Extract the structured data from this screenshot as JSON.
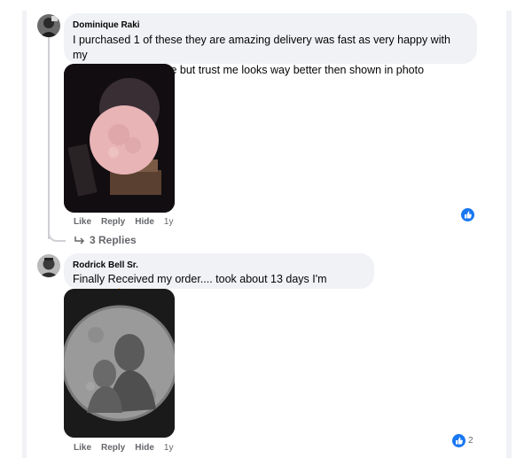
{
  "comments": [
    {
      "author": "Dominique Raki",
      "text_line1": "I purchased 1 of these they are amazing delivery was fast as very happy with my",
      "text_line2": "purchase this is mine but trust me looks way better then shown in photo",
      "actions": {
        "like": "Like",
        "reply": "Reply",
        "hide": "Hide",
        "time": "1y"
      },
      "replies_label": "3 Replies",
      "reaction_count": ""
    },
    {
      "author": "Rodrick Bell Sr.",
      "text": "Finally Received my order.... took about 13 days I'm grateful 👌",
      "actions": {
        "like": "Like",
        "reply": "Reply",
        "hide": "Hide",
        "time": "1y"
      },
      "reaction_count": "2"
    }
  ],
  "colors": {
    "bubble": "#f0f2f5",
    "meta_text": "#65676b",
    "like_blue": "#1877f2"
  },
  "icons": [
    "reply-arrow-icon",
    "like-reaction-icon"
  ]
}
